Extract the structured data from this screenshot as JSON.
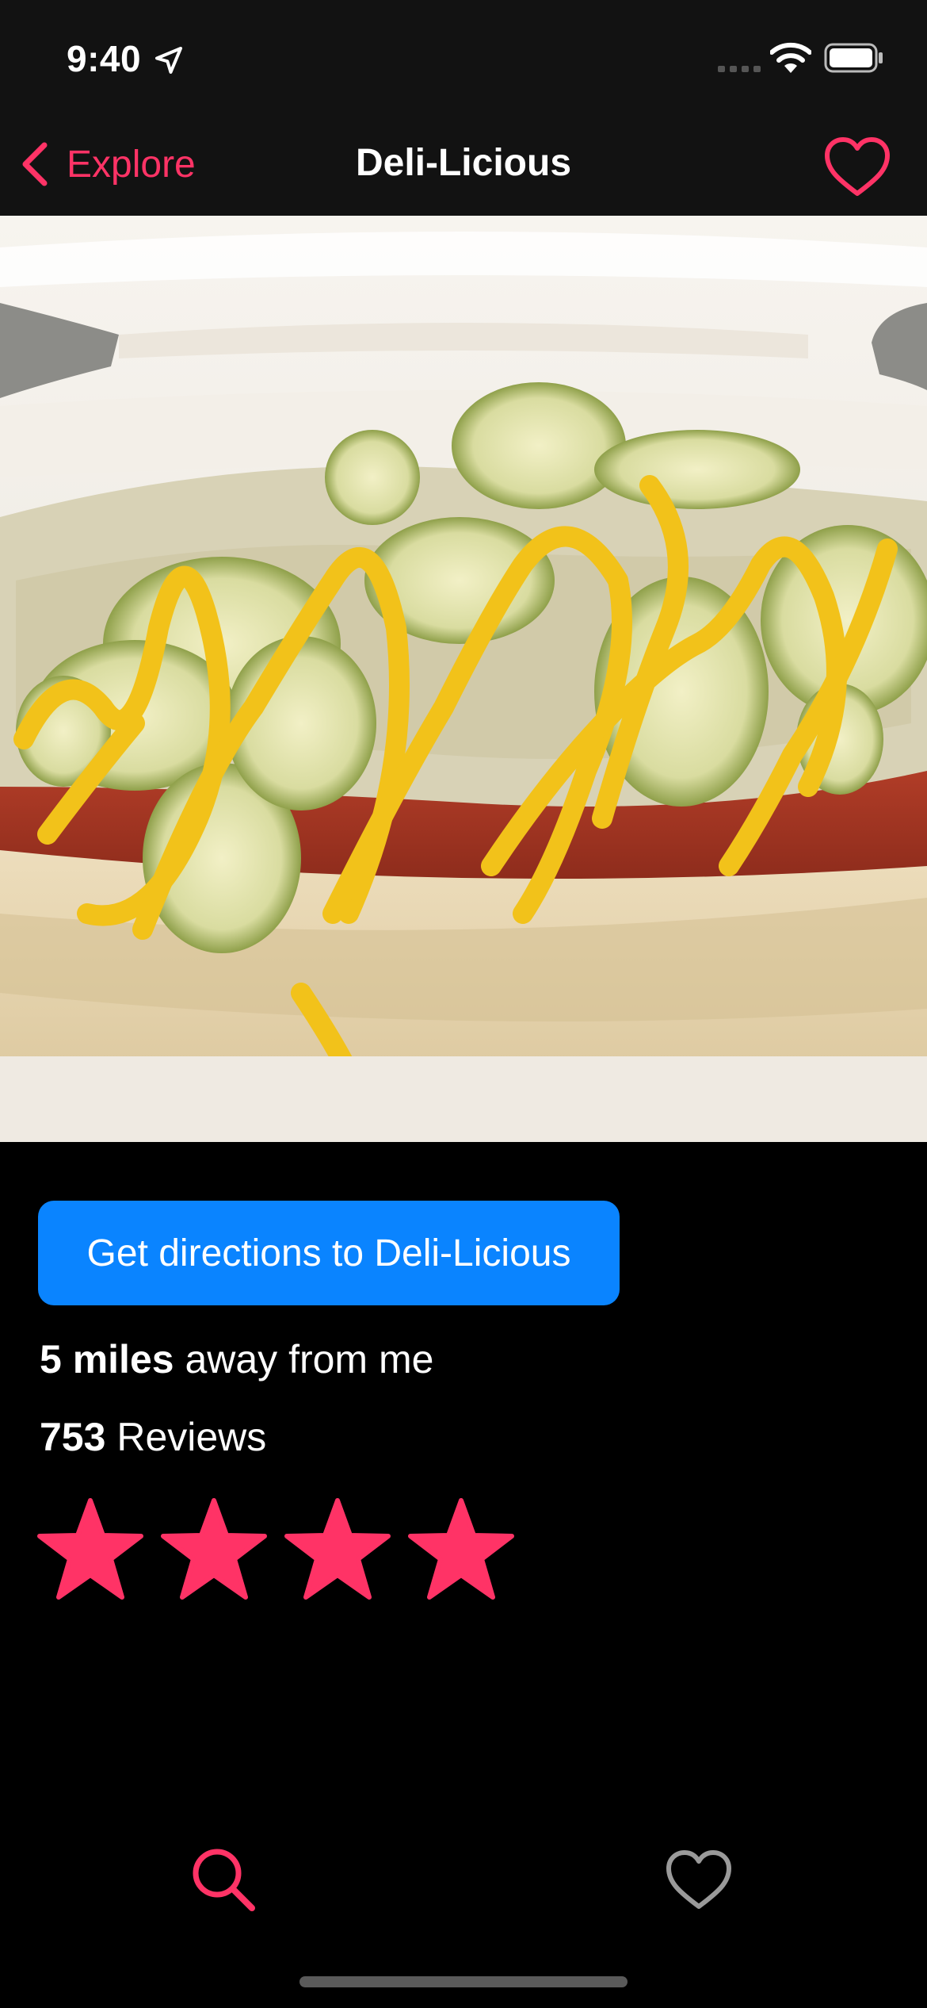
{
  "status_bar": {
    "time": "9:40",
    "icons": [
      "location-arrow-icon",
      "cellular-signal-icon",
      "wifi-icon",
      "battery-icon"
    ]
  },
  "nav": {
    "back_label": "Explore",
    "title": "Deli-Licious",
    "favorite_icon": "heart-outline-icon"
  },
  "hero": {
    "image_subject": "hot dog with pickles, sauerkraut and mustard"
  },
  "details": {
    "directions_button": "Get directions to Deli-Licious",
    "distance_value": "5 miles",
    "distance_suffix": " away from me",
    "review_count": "753",
    "review_suffix": " Reviews",
    "rating": 4,
    "rating_max": 4
  },
  "tab_bar": {
    "tabs": [
      {
        "icon": "search-icon",
        "active": true
      },
      {
        "icon": "heart-outline-icon",
        "active": false
      }
    ]
  },
  "colors": {
    "accent": "#ff3366",
    "button_blue": "#0a84ff",
    "background": "#000000",
    "nav_background": "#121212",
    "inactive_tab": "#9a9a9a"
  }
}
